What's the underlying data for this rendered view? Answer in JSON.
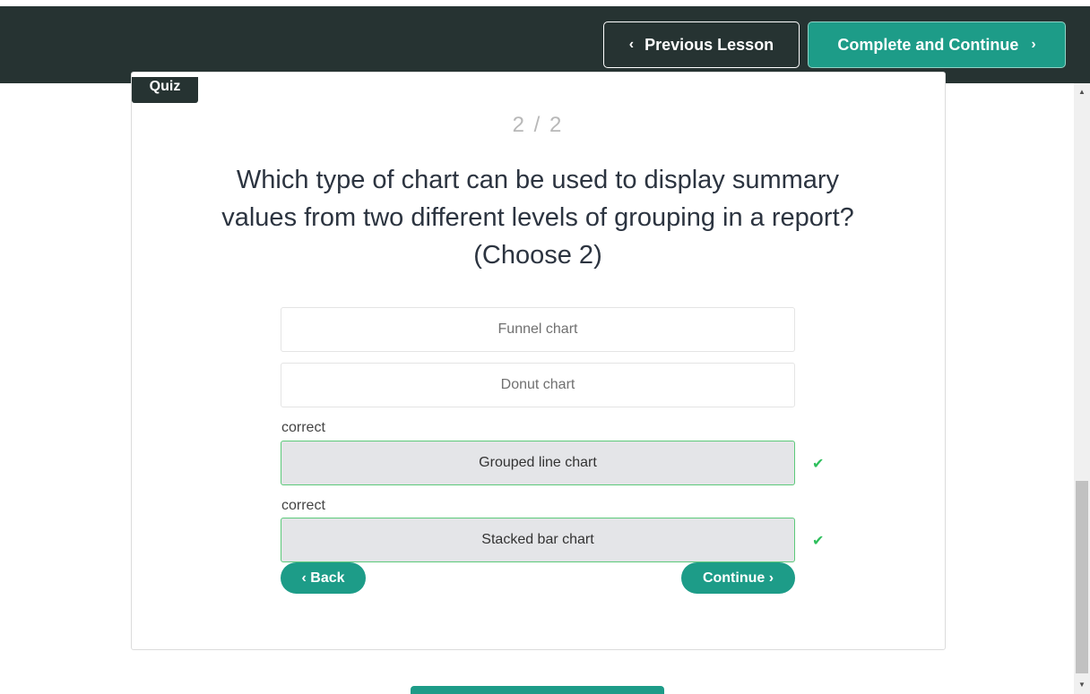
{
  "header": {
    "prev_label": "Previous Lesson",
    "next_label": "Complete and Continue"
  },
  "quiz": {
    "tag": "Quiz",
    "counter": "2 / 2",
    "question": "Which type of chart can be used to display summary values from two different levels of grouping in a report? (Choose 2)",
    "options": [
      {
        "label": "Funnel chart",
        "status": ""
      },
      {
        "label": "Donut chart",
        "status": ""
      },
      {
        "label": "Grouped line chart",
        "status": "correct"
      },
      {
        "label": "Stacked bar chart",
        "status": "correct"
      }
    ],
    "back_label": "‹ Back",
    "continue_label": "Continue ›"
  },
  "colors": {
    "header_bg": "#263332",
    "accent": "#1d9c88",
    "correct_border": "#5cc97a",
    "check": "#2fbf5d"
  },
  "icons": {
    "prev": "chevron-left-icon",
    "next": "chevron-right-icon",
    "correct": "checkmark-icon"
  }
}
